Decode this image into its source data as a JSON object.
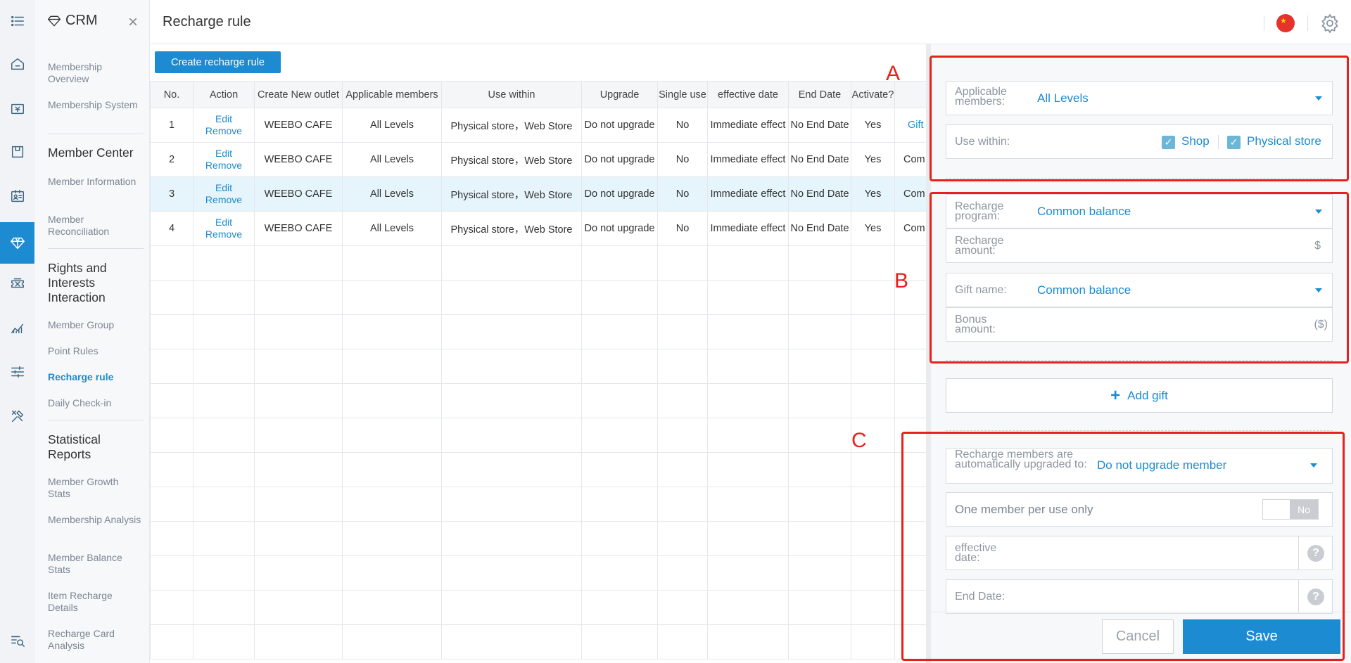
{
  "menu": {
    "brand": "CRM",
    "close": "×",
    "items": [
      {
        "label": "Membership Overview"
      },
      {
        "label": "Membership System"
      },
      {
        "label": "Member Center"
      },
      {
        "label": "Member Information"
      },
      {
        "label": "Member Reconciliation"
      },
      {
        "label": "Rights and Interests Interaction"
      },
      {
        "label": "Member Group"
      },
      {
        "label": "Point Rules"
      },
      {
        "label": "Recharge rule"
      },
      {
        "label": "Daily Check-in"
      },
      {
        "label": "Statistical Reports"
      },
      {
        "label": "Member Growth Stats"
      },
      {
        "label": "Membership Analysis"
      },
      {
        "label": "Member Balance Stats"
      },
      {
        "label": "Item Recharge Details"
      },
      {
        "label": "Recharge Card Analysis"
      }
    ]
  },
  "header": {
    "title": "Recharge rule"
  },
  "toolbar": {
    "create_label": "Create recharge rule"
  },
  "table": {
    "columns": [
      "No.",
      "Action",
      "Create New outlet",
      "Applicable members",
      "Use within",
      "Upgrade",
      "Single use",
      "effective date",
      "End Date",
      "Activate?",
      ""
    ],
    "edit": "Edit",
    "remove": "Remove",
    "rows": [
      {
        "no": "1",
        "outlet": "WEEBO CAFE",
        "members": "All Levels",
        "use": "Physical store，Web Store",
        "upgrade": "Do not upgrade",
        "single": "No",
        "effective": "Immediate effect",
        "end": "No End Date",
        "active": "Yes",
        "extra": "Gift"
      },
      {
        "no": "2",
        "outlet": "WEEBO CAFE",
        "members": "All Levels",
        "use": "Physical store，Web Store",
        "upgrade": "Do not upgrade",
        "single": "No",
        "effective": "Immediate effect",
        "end": "No End Date",
        "active": "Yes",
        "extra": "Com"
      },
      {
        "no": "3",
        "outlet": "WEEBO CAFE",
        "members": "All Levels",
        "use": "Physical store，Web Store",
        "upgrade": "Do not upgrade",
        "single": "No",
        "effective": "Immediate effect",
        "end": "No End Date",
        "active": "Yes",
        "extra": "Com"
      },
      {
        "no": "4",
        "outlet": "WEEBO CAFE",
        "members": "All Levels",
        "use": "Physical store，Web Store",
        "upgrade": "Do not upgrade",
        "single": "No",
        "effective": "Immediate effect",
        "end": "No End Date",
        "active": "Yes",
        "extra": "Com"
      }
    ]
  },
  "panel": {
    "applicable_label": "Applicable members:",
    "applicable_value": "All Levels",
    "use_within_label": "Use within:",
    "use_within_options": [
      "Shop",
      "Physical store"
    ],
    "recharge_program_label": "Recharge program:",
    "recharge_program_value": "Common balance",
    "recharge_amount_label": "Recharge amount:",
    "recharge_amount_unit": "$",
    "gift_name_label": "Gift name:",
    "gift_name_value": "Common balance",
    "bonus_amount_label": "Bonus amount:",
    "bonus_amount_unit": "($)",
    "add_gift": "Add gift",
    "upgrade_label": "Recharge members are automatically upgraded to:",
    "upgrade_value": "Do not upgrade member",
    "single_use_label": "One member per use only",
    "single_use_state": "No",
    "effective_label": "effective date:",
    "end_label": "End Date:",
    "help": "?",
    "cancel": "Cancel",
    "save": "Save"
  },
  "annotations": {
    "a": "A",
    "b": "B",
    "c": "C"
  }
}
